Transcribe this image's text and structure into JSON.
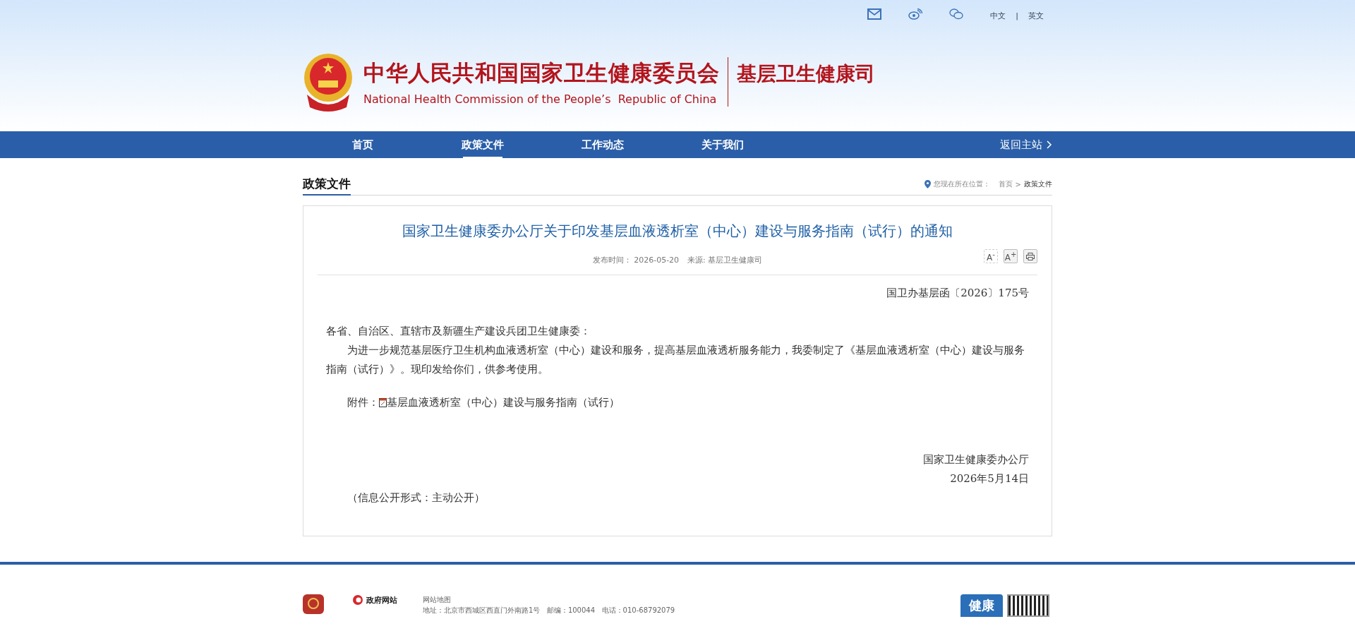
{
  "top_bar": {
    "languages": [
      {
        "label": "中文",
        "selected": false
      },
      {
        "label": "英文",
        "selected": false
      }
    ],
    "separator": "|"
  },
  "header": {
    "title_cn": "中华人民共和国国家卫生健康委员会",
    "title_en": "National Health Commission of the People’s  Republic of China",
    "department": "基层卫生健康司"
  },
  "nav": {
    "items": [
      {
        "label": "首页",
        "selected": false
      },
      {
        "label": "政策文件",
        "selected": true
      },
      {
        "label": "工作动态",
        "selected": false
      },
      {
        "label": "关于我们",
        "selected": false
      }
    ],
    "return_link": "返回主站"
  },
  "section": {
    "title": "政策文件",
    "breadcrumb": {
      "prefix": "您现在所在位置：",
      "items": [
        "首页",
        "政策文件"
      ],
      "separator": ">"
    }
  },
  "article": {
    "title": "国家卫生健康委办公厅关于印发基层血液透析室（中心）建设与服务指南（试行）的通知",
    "meta": [
      {
        "label": "发布时间：",
        "value": "2026-05-20"
      },
      {
        "label": "来源:",
        "value": "基层卫生健康司"
      }
    ],
    "tools": [
      {
        "kind": "font",
        "label": "A$^{-}$"
      },
      {
        "kind": "font",
        "label": "A$^{+}$"
      },
      {
        "kind": "print"
      }
    ],
    "doc_number": "国卫办基层函〔2026〕175号",
    "salutation": "各省、自治区、直辖市及新疆生产建设兵团卫生健康委：",
    "paragraphs": [
      "为进一步规范基层医疗卫生机构血液透析室（中心）建设和服务，提高基层血液透析服务能力，我委制定了《基层血液透析室（中心）建设与服务指南（试行）》。现印发给你们，供参考使用。"
    ],
    "attachment": {
      "label": "附件：",
      "link": "基层血液透析室（中心）建设与服务指南（试行）"
    },
    "signature": {
      "org": "国家卫生健康委办公厅",
      "date": "2026年5月14日"
    },
    "disclosure": "（信息公开形式：主动公开）"
  },
  "footer": {
    "gov_logo_text": "政府网站",
    "links": [
      "网站地图"
    ],
    "address": "地址：北京市西城区西直门外南路1号   邮编：100044   电话：010-68792079",
    "badge_text": "健康"
  }
}
